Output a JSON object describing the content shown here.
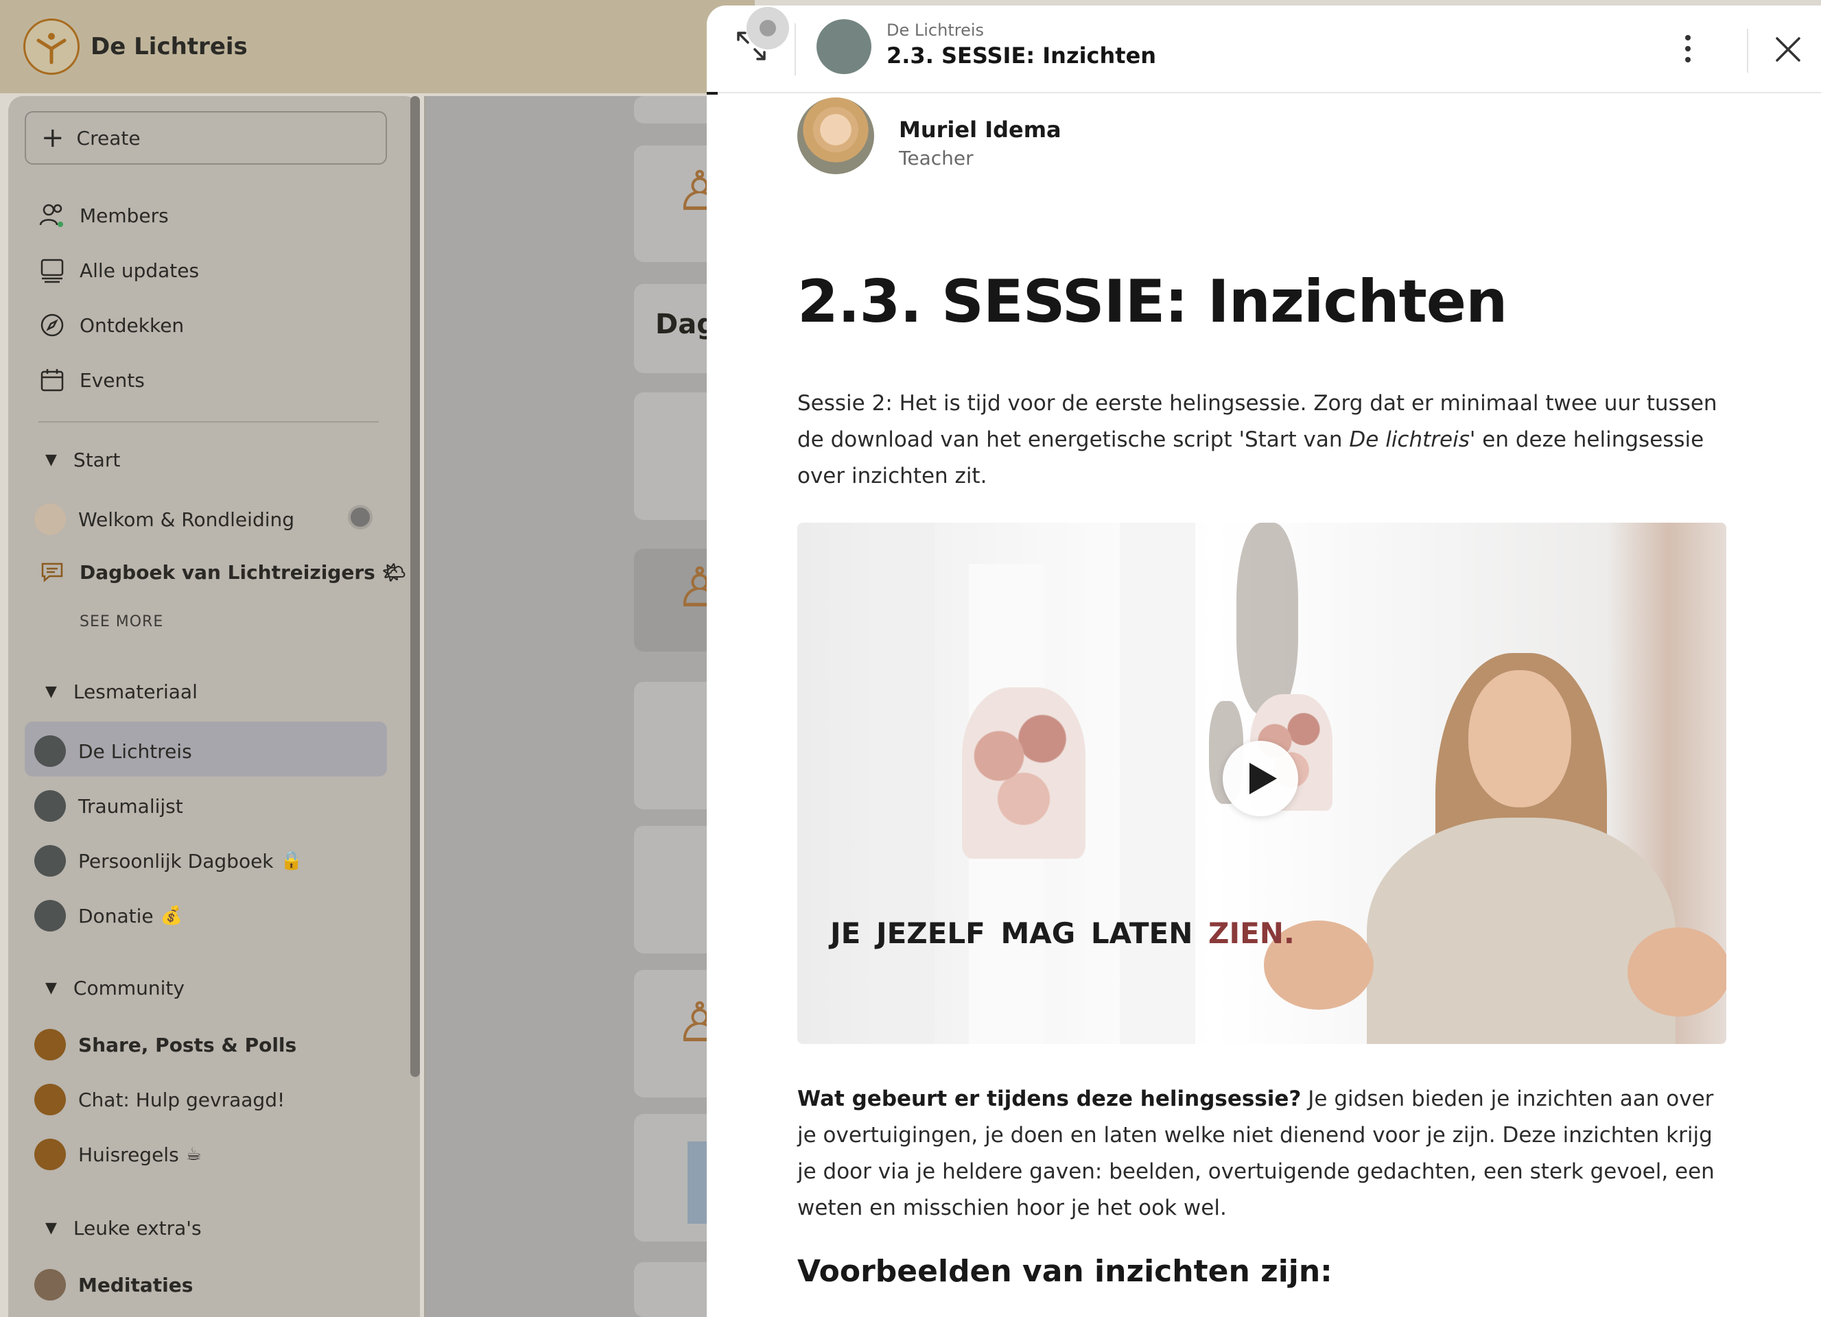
{
  "app": {
    "brand": "De Lichtreis"
  },
  "sidebar": {
    "create_label": "Create",
    "nav": [
      {
        "label": "Members",
        "icon": "members-icon"
      },
      {
        "label": "Alle updates",
        "icon": "updates-icon"
      },
      {
        "label": "Ontdekken",
        "icon": "compass-icon"
      },
      {
        "label": "Events",
        "icon": "calendar-icon"
      }
    ],
    "sections": {
      "start": {
        "label": "Start",
        "items": [
          "Welkom & Rondleiding",
          "Dagboek van Lichtreizigers"
        ],
        "see_more": "SEE MORE"
      },
      "lesmateriaal": {
        "label": "Lesmateriaal",
        "items": [
          "De Lichtreis",
          "Traumalijst",
          "Persoonlijk Dagboek",
          "Donatie"
        ]
      },
      "community": {
        "label": "Community",
        "items": [
          "Share, Posts & Polls",
          "Chat: Hulp gevraagd!",
          "Huisregels"
        ]
      },
      "extras": {
        "label": "Leuke extra's",
        "items": [
          "Meditaties"
        ]
      }
    }
  },
  "middle": {
    "card_title": "Dag"
  },
  "modal": {
    "space_name": "De Lichtreis",
    "title": "2.3. SESSIE: Inzichten",
    "author": {
      "name": "Muriel Idema",
      "role": "Teacher"
    },
    "post_title": "2.3. SESSIE: Inzichten",
    "intro": {
      "part1": "Sessie 2: Het is tijd voor de eerste helingsessie. Zorg dat er minimaal twee uur tussen de download van het energetische script 'Start van ",
      "italic": "De lichtreis'",
      "part2": " en deze helingsessie over inzichten zit."
    },
    "video": {
      "caption_main": "JE  JEZELF  MAG LATEN ",
      "caption_accent": "ZIEN."
    },
    "body": {
      "lead": "Wat gebeurt er tijdens deze helingsessie?",
      "text": " Je gidsen bieden je inzichten aan over je overtuigingen, je doen en laten welke niet dienend voor je zijn. Deze inzichten krijg je door via je heldere gaven: beelden, overtuigende gedachten, een sterk gevoel, een weten en misschien hoor je het ook wel."
    },
    "sub_heading": "Voorbeelden van inzichten zijn:"
  }
}
